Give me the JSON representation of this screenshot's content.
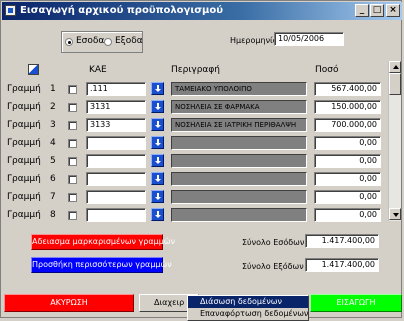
{
  "window": {
    "title": "Εισαγωγή αρχικού προϋπολογισμού",
    "min_label": "_",
    "max_label": "□",
    "close_label": "×"
  },
  "type_group": {
    "options": [
      {
        "label": "Εσοδα",
        "selected": true
      },
      {
        "label": "Εξοδα",
        "selected": false
      }
    ]
  },
  "date": {
    "label": "Ημερομηνία",
    "value": "10/05/2006"
  },
  "grid": {
    "headers": {
      "kae": "ΚΑΕ",
      "description": "Περιγραφή",
      "amount": "Ποσό"
    },
    "rows": [
      {
        "label": "Γραμμή",
        "num": "1",
        "kae": ".111",
        "description": "ΤΑΜΕΙΑΚΟ ΥΠΟΛΟΙΠΟ",
        "amount": "567.400,00"
      },
      {
        "label": "Γραμμή",
        "num": "2",
        "kae": "3131",
        "description": "ΝΟΣΗΛΕΙΑ ΣΕ ΦΑΡΜΑΚΑ",
        "amount": "150.000,00"
      },
      {
        "label": "Γραμμή",
        "num": "3",
        "kae": "3133",
        "description": "ΝΟΣΗΛΕΙΑ ΣΕ ΙΑΤΡΙΚΗ ΠΕΡΙΘΑΛΨΗ",
        "amount": "700.000,00"
      },
      {
        "label": "Γραμμή",
        "num": "4",
        "kae": "",
        "description": "",
        "amount": "0,00"
      },
      {
        "label": "Γραμμή",
        "num": "5",
        "kae": "",
        "description": "",
        "amount": "0,00"
      },
      {
        "label": "Γραμμή",
        "num": "6",
        "kae": "",
        "description": "",
        "amount": "0,00"
      },
      {
        "label": "Γραμμή",
        "num": "7",
        "kae": "",
        "description": "",
        "amount": "0,00"
      },
      {
        "label": "Γραμμή",
        "num": "8",
        "kae": "",
        "description": "",
        "amount": "0,00"
      }
    ]
  },
  "buttons": {
    "clear_marked": "Αδειασμα μαρκαρισμένων γραμμών",
    "add_rows": "Προσθήκη περισσότερων γραμμών",
    "cancel": "ΑΚΥΡΩΣΗ",
    "manage": "Διαχειρ",
    "insert": "ΕΙΣΑΓΩΓΗ"
  },
  "totals": {
    "income_label": "Σύνολο Εσόδων",
    "income_value": "1.417.400,00",
    "expense_label": "Σύνολο Εξόδων",
    "expense_value": "1.417.400,00"
  },
  "dropdown_menu": {
    "items": [
      {
        "label": "Διάσωση δεδομένων",
        "highlighted": true
      },
      {
        "label": "Επαναφόρτωση δεδομένων",
        "highlighted": false
      }
    ]
  },
  "colors": {
    "titlebar": "#0a246a",
    "clear_button": "#ff0000",
    "add_button": "#0000ff",
    "cancel_button": "#ff0000",
    "insert_button": "#00ff00",
    "lookup_button": "#1a4fcf",
    "description_field": "#808080"
  }
}
